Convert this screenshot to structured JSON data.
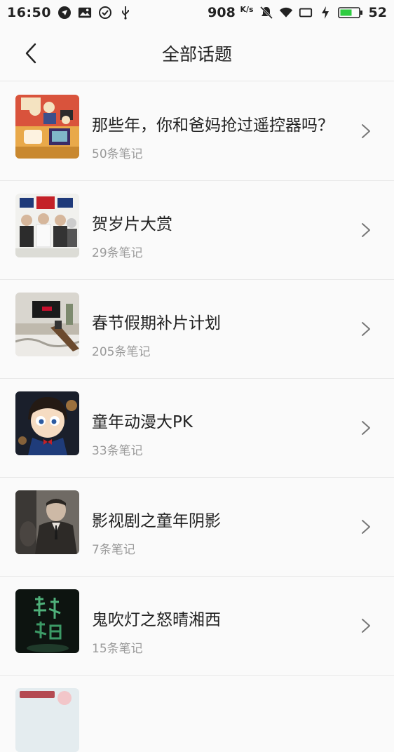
{
  "status_bar": {
    "time": "16:50",
    "net_speed": "908",
    "net_unit": "K/s",
    "battery": "52"
  },
  "header": {
    "title": "全部话题"
  },
  "topics": [
    {
      "title": "那些年，你和爸妈抢过遥控器吗？",
      "count": "50条笔记",
      "image": "family-tv-illustration"
    },
    {
      "title": "贺岁片大赏",
      "count": "29条笔记",
      "image": "movie-poster-wedding"
    },
    {
      "title": "春节假期补片计划",
      "count": "205条笔记",
      "image": "netflix-tv-room"
    },
    {
      "title": "童年动漫大PK",
      "count": "33条笔记",
      "image": "anime-detective"
    },
    {
      "title": "影视剧之童年阴影",
      "count": "7条笔记",
      "image": "film-still-man"
    },
    {
      "title": "鬼吹灯之怒晴湘西",
      "count": "15条笔记",
      "image": "dark-drama-poster"
    }
  ],
  "colors": {
    "background": "#fafafa",
    "divider": "#e8e8e8",
    "text_primary": "#222222",
    "text_secondary": "#9a9a9a",
    "battery_green": "#2ecc40"
  }
}
